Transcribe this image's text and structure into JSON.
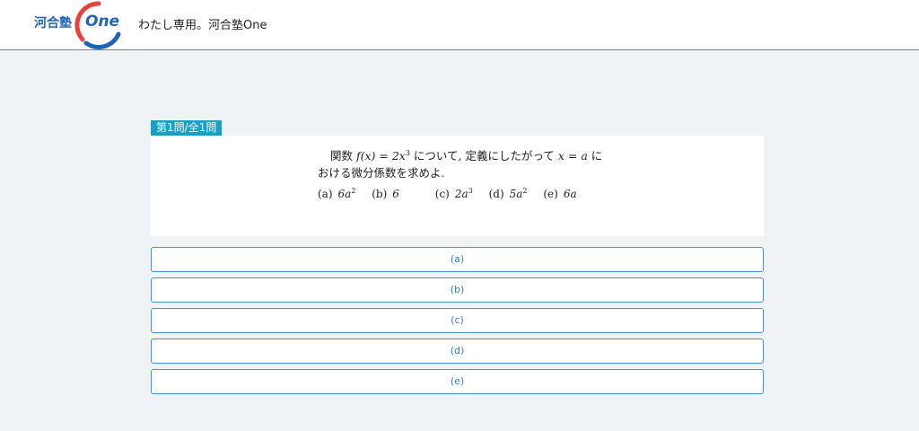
{
  "header": {
    "logo_kanji": "河合塾",
    "logo_one": "One",
    "site_title": "わたし専用。河合塾One"
  },
  "question": {
    "badge": "第1問/全1問",
    "line1_prefix": "関数 ",
    "line1_func": "f(x) = 2x",
    "line1_exp": "3",
    "line1_mid": " について, 定義にしたがって ",
    "line1_var": "x = a",
    "line1_suffix": " に",
    "line2": "おける微分係数を求めよ.",
    "choices": [
      {
        "label": "(a)",
        "value": "6a",
        "exp": "2"
      },
      {
        "label": "(b)",
        "value": "6",
        "exp": ""
      },
      {
        "label": "(c)",
        "value": "2a",
        "exp": "3"
      },
      {
        "label": "(d)",
        "value": "5a",
        "exp": "2"
      },
      {
        "label": "(e)",
        "value": "6a",
        "exp": ""
      }
    ]
  },
  "answers": [
    "(a)",
    "(b)",
    "(c)",
    "(d)",
    "(e)"
  ],
  "colors": {
    "brand": "#1e63b8",
    "badge": "#1a9fc7",
    "button_border": "#3d93df",
    "logo_red": "#e8433a"
  }
}
